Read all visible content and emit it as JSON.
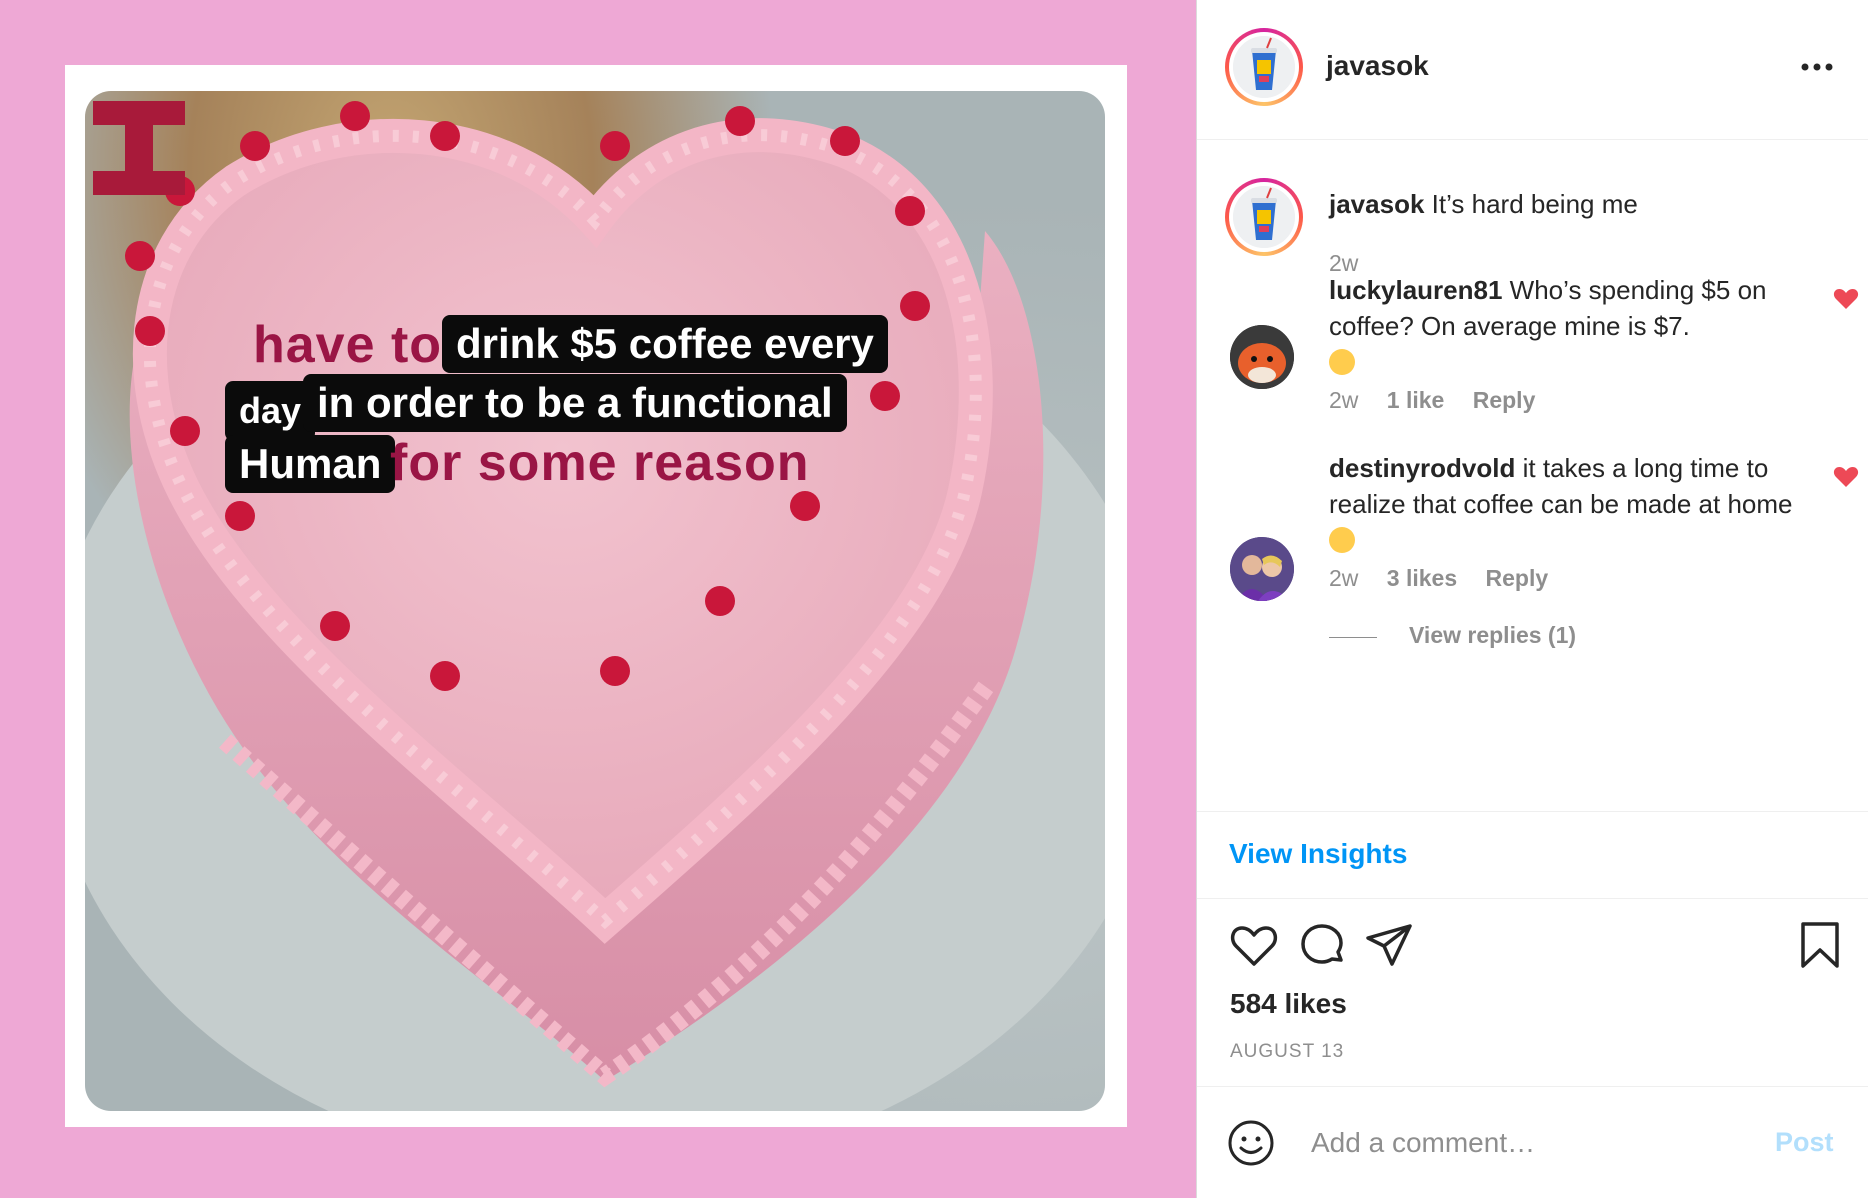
{
  "post": {
    "username": "javasok",
    "caption": "It’s hard being me",
    "caption_time": "2w",
    "likes": "584 likes",
    "date": "AUGUST 13"
  },
  "image_text": {
    "line1_plain": "have to",
    "line1_box": "drink $5 coffee every",
    "line2_box_small": "day",
    "line2_box": "in order to be a functional",
    "line3_box": "Human",
    "line3_plain": "for some reason"
  },
  "comments": [
    {
      "username": "luckylauren81",
      "text": "Who’s spending $5 on coffee? On average mine is $7.",
      "emoji": "grinning-squinting-face",
      "time": "2w",
      "likes": "1 like",
      "reply": "Reply",
      "liked": true
    },
    {
      "username": "destinyrodvold",
      "text": "it takes a long time to realize that coffee can be made at home",
      "emoji": "hushed-face",
      "time": "2w",
      "likes": "3 likes",
      "reply": "Reply",
      "liked": true,
      "view_replies": "View replies (1)"
    }
  ],
  "insights_label": "View Insights",
  "comment_box": {
    "placeholder": "Add a comment…",
    "post_label": "Post"
  },
  "colors": {
    "background_pink": "#eea8d5",
    "link_blue": "#0095f6",
    "like_red": "#ed4956",
    "muted": "#8e8e8e"
  },
  "icons": [
    "more-options-icon",
    "like-icon",
    "comment-icon",
    "share-icon",
    "bookmark-icon",
    "emoji-icon",
    "heart-icon"
  ]
}
